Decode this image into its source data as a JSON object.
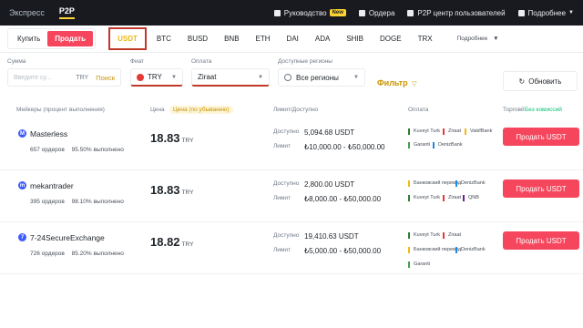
{
  "topbar": {
    "tab_express": "Экспресс",
    "tab_p2p": "P2P",
    "guide": "Руководство",
    "guide_badge": "New",
    "orders": "Ордера",
    "user_center": "P2P центр пользователей",
    "more": "Подробнее"
  },
  "trade": {
    "buy": "Купить",
    "sell": "Продать"
  },
  "assets": [
    "USDT",
    "BTC",
    "BUSD",
    "BNB",
    "ETH",
    "DAI",
    "ADA",
    "SHIB",
    "DOGE",
    "TRX"
  ],
  "more_dropdown": "Подробнее",
  "filters": {
    "amount_label": "Сумма",
    "amount_placeholder": "Введите су...",
    "amount_currency": "TRY",
    "amount_search": "Поиск",
    "fiat_label": "Фиат",
    "fiat_value": "TRY",
    "payment_label": "Оплата",
    "payment_value": "Ziraat",
    "regions_label": "Доступные регионы",
    "regions_value": "Все регионы",
    "filter_button": "Фильтр",
    "refresh_button": "Обновить"
  },
  "table_headers": {
    "maker": "Мейкеры (процент выполнения)",
    "price": "Цена",
    "price_sort": "Цена (по убыванию)",
    "limit": "Лимит/Доступно",
    "payment": "Оплата",
    "trade": "Торговй",
    "no_fee": "Без комиссий"
  },
  "ads": [
    {
      "initial": "M",
      "name": "Masterless",
      "orders": "657 ордеров",
      "completion": "95.50% выполнено",
      "price": "18.83",
      "currency": "TRY",
      "available_label": "Доступно",
      "available": "5,094.68 USDT",
      "limit_label": "Лимит",
      "limit": "₺10,000.00 - ₺50,000.00",
      "payments": [
        {
          "name": "Kuveyt Turk",
          "color": "#2e7d32"
        },
        {
          "name": "Ziraat",
          "color": "#e53935"
        },
        {
          "name": "VakifBank",
          "color": "#f0b90b"
        },
        {
          "name": "Garanti",
          "color": "#43a047"
        },
        {
          "name": "DenizBank",
          "color": "#1e88e5"
        }
      ],
      "button": "Продать USDT"
    },
    {
      "initial": "m",
      "name": "mekantrader",
      "orders": "395 ордеров",
      "completion": "98.10% выполнено",
      "price": "18.83",
      "currency": "TRY",
      "available_label": "Доступно",
      "available": "2,800.00 USDT",
      "limit_label": "Лимит",
      "limit": "₺8,000.00 - ₺50,000.00",
      "payments": [
        {
          "name": "Банковский перевод",
          "color": "#f0b90b"
        },
        {
          "name": "DenizBank",
          "color": "#1e88e5"
        },
        {
          "name": "Kuveyt Turk",
          "color": "#2e7d32"
        },
        {
          "name": "Ziraat",
          "color": "#e53935"
        },
        {
          "name": "QNB",
          "color": "#6a1b9a"
        }
      ],
      "button": "Продать USDT"
    },
    {
      "initial": "7",
      "name": "7-24SecureExchange",
      "orders": "726 ордеров",
      "completion": "85.20% выполнено",
      "price": "18.82",
      "currency": "TRY",
      "available_label": "Доступно",
      "available": "19,410.63 USDT",
      "limit_label": "Лимит",
      "limit": "₺5,000.00 - ₺50,000.00",
      "payments": [
        {
          "name": "Kuveyt Turk",
          "color": "#2e7d32"
        },
        {
          "name": "Ziraat",
          "color": "#e53935"
        },
        {
          "name": "Банковский перевод",
          "color": "#f0b90b"
        },
        {
          "name": "DenizBank",
          "color": "#1e88e5"
        },
        {
          "name": "Garanti",
          "color": "#43a047"
        }
      ],
      "button": "Продать USDT"
    }
  ]
}
